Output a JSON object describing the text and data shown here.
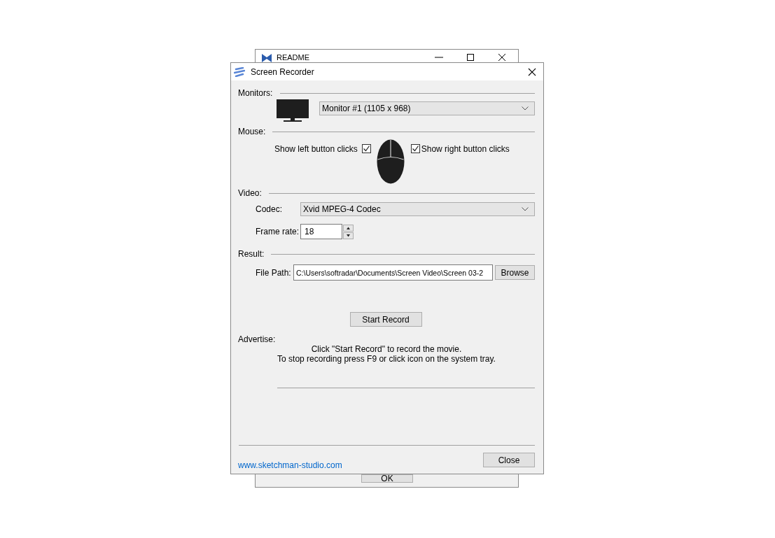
{
  "background_window": {
    "title": "README",
    "ok_button": "OK"
  },
  "dialog": {
    "title": "Screen Recorder",
    "monitors": {
      "label": "Monitors:",
      "selected_monitor": "Monitor #1 (1105 x 968)"
    },
    "mouse": {
      "label": "Mouse:",
      "left_clicks": {
        "label": "Show left button clicks",
        "checked": true
      },
      "right_clicks": {
        "label": "Show right button clicks",
        "checked": true
      }
    },
    "video": {
      "label": "Video:",
      "codec_label": "Codec:",
      "codec": "Xvid MPEG-4 Codec",
      "frame_rate_label": "Frame rate:",
      "frame_rate": "18"
    },
    "result": {
      "label": "Result:",
      "file_path_label": "File Path:",
      "file_path": "C:\\Users\\softradar\\Documents\\Screen Video\\Screen 03-2",
      "browse_button": "Browse"
    },
    "start_button": "Start Record",
    "advertise": {
      "label": "Advertise:",
      "lines": [
        "Click \"Start Record\" to record the movie.",
        "To stop recording press F9 or click icon on the system tray."
      ]
    },
    "link": "www.sketchman-studio.com",
    "close_button": "Close"
  }
}
